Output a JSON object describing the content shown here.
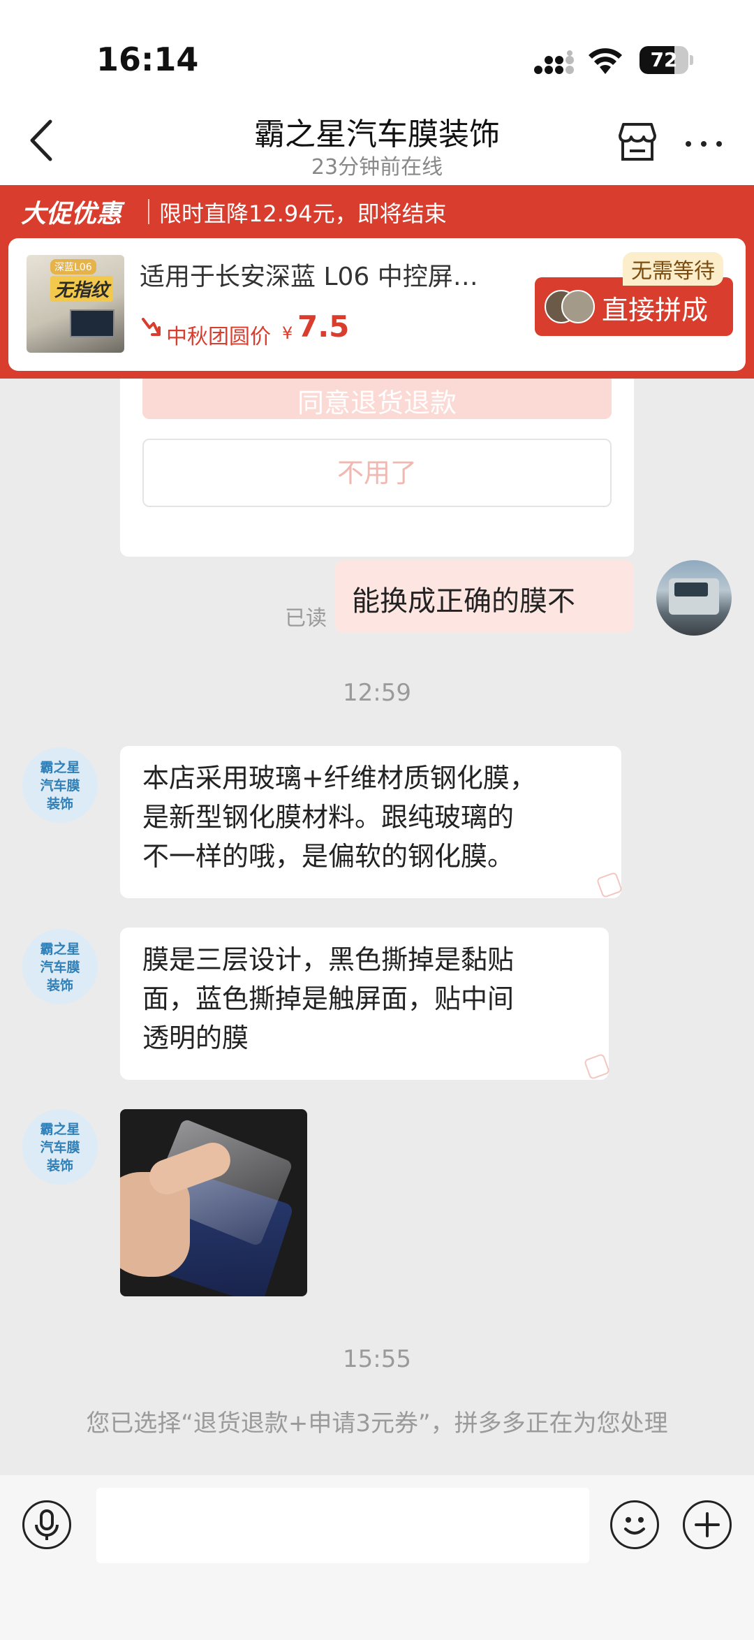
{
  "status_bar": {
    "time": "16:14",
    "battery": "72",
    "battery_level": 0.72
  },
  "header": {
    "title": "霸之星汽车膜装饰",
    "subtitle": "23分钟前在线"
  },
  "promo": {
    "tag": "大促优惠",
    "text": "限时直降12.94元，即将结束",
    "product": {
      "thumb_badge_top": "深蓝L06",
      "thumb_badge_main": "无指纹",
      "title": "适用于长安深蓝 L06 中控屏…",
      "price_label": "中秋团圆价",
      "currency": "¥",
      "price": "7.5"
    },
    "no_wait_badge": "无需等待",
    "join_button": "直接拼成"
  },
  "chat": {
    "card_agree_button": "同意退货退款",
    "card_decline_button": "不用了",
    "read_label": "已读",
    "outgoing_message": "能换成正确的膜不",
    "timestamp_1": "12:59",
    "shop_avatar": {
      "line1": "霸之星",
      "line2": "汽车膜",
      "line3": "装饰"
    },
    "messages": [
      {
        "line1": "本店采用玻璃+纤维材质钢化膜，",
        "line2": "是新型钢化膜材料。跟纯玻璃的",
        "line3": "不一样的哦，是偏软的钢化膜。"
      },
      {
        "line1": "膜是三层设计，黑色撕掉是黏贴",
        "line2": "面，蓝色撕掉是触屏面，贴中间",
        "line3": "透明的膜"
      }
    ],
    "timestamp_2": "15:55",
    "system_message": "您已选择“退货退款+申请3元券”，拼多多正在为您处理"
  },
  "input": {
    "placeholder": ""
  },
  "colors": {
    "accent": "#d83d2e",
    "bubble_out": "#fde6e2",
    "background": "#ebebeb"
  },
  "icons": [
    "back-icon",
    "store-icon",
    "more-icon",
    "mic-icon",
    "emoji-icon",
    "plus-icon",
    "trend-down-icon",
    "wifi-icon",
    "signal-icon"
  ]
}
